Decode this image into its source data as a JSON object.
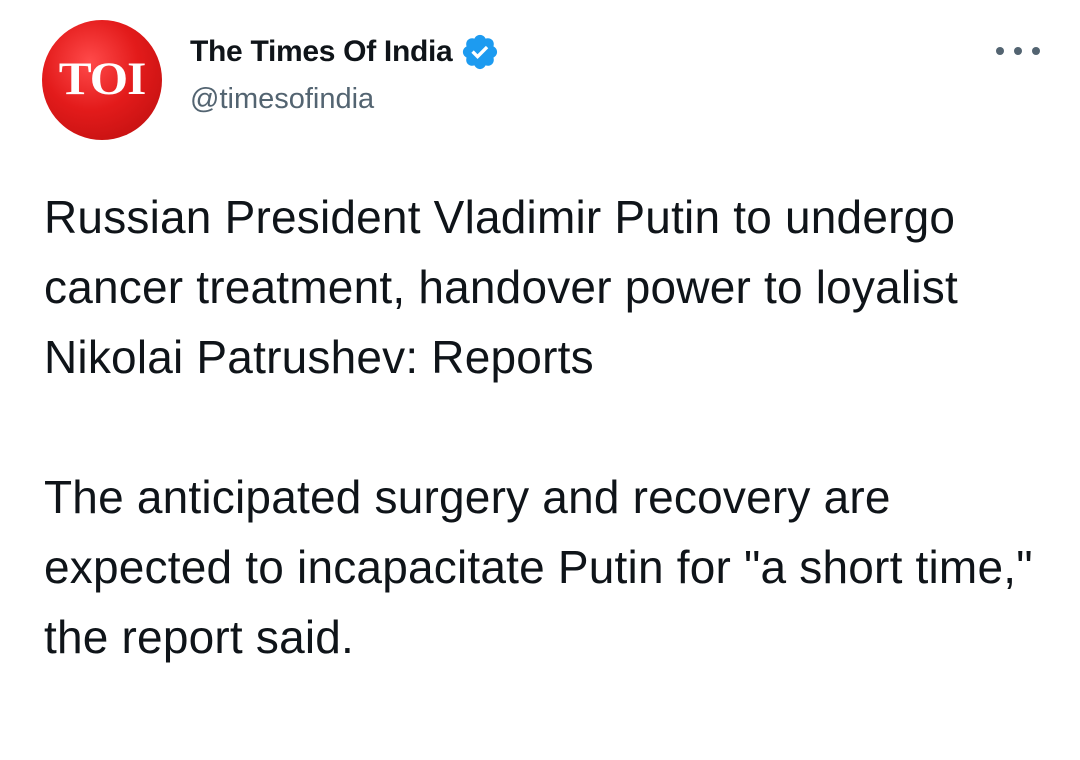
{
  "author": {
    "avatar_text": "TOI",
    "display_name": "The Times Of India",
    "handle": "@timesofindia",
    "verified": true,
    "avatar_color": "#e31b1b",
    "verified_color": "#1d9bf0"
  },
  "tweet": {
    "paragraphs": [
      "Russian President Vladimir Putin to undergo cancer treatment, handover power to loyalist Nikolai Patrushev: Reports",
      "The anticipated surgery and recovery are expected to incapacitate Putin for \"a short time,\" the report said."
    ]
  },
  "icons": {
    "more": "more-options-icon",
    "verified": "verified-badge-icon"
  }
}
